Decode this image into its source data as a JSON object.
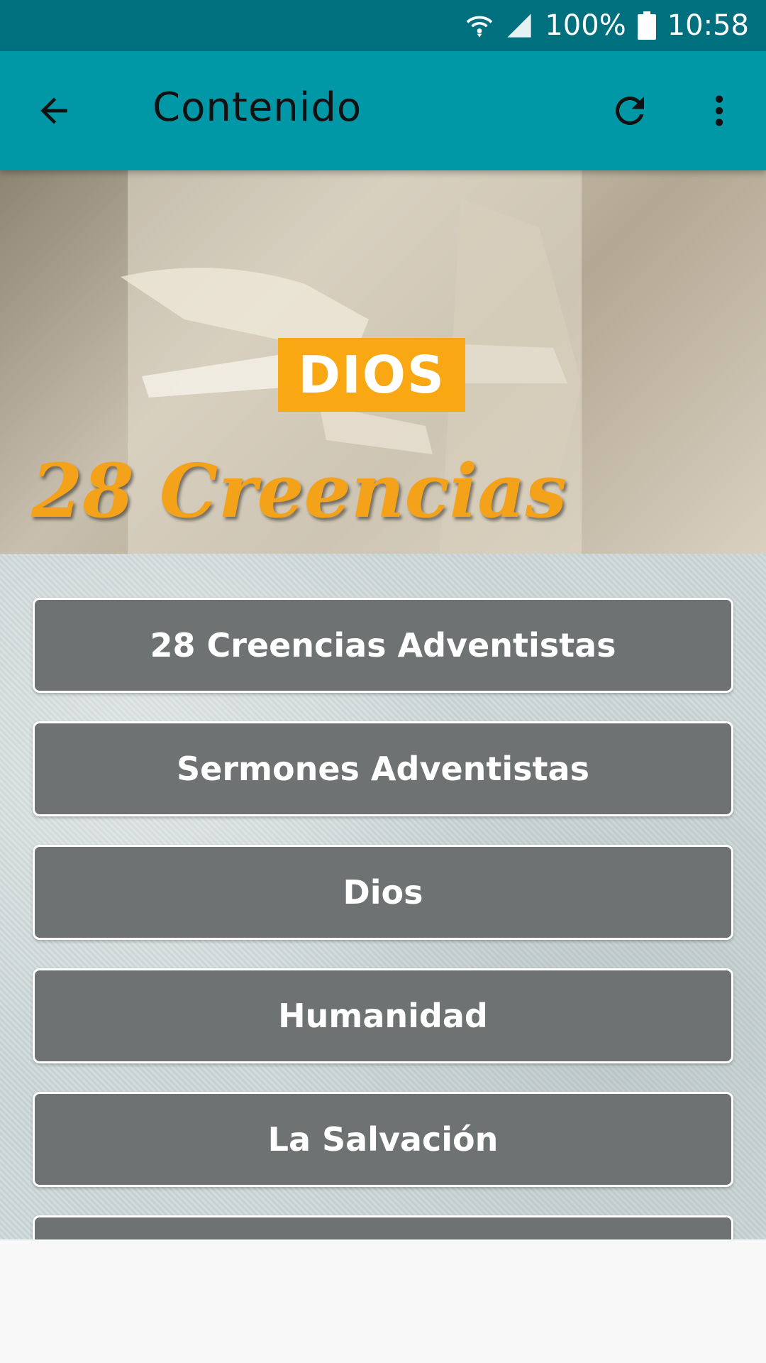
{
  "status_bar": {
    "battery": "100%",
    "time": "10:58"
  },
  "app_bar": {
    "title": "Contenido",
    "accent_color": "#0097a7"
  },
  "banner": {
    "badge_text": "DIOS",
    "logo_text": "28 Creencias",
    "badge_color": "#f9a813"
  },
  "menu": {
    "items": [
      {
        "label": "28 Creencias Adventistas"
      },
      {
        "label": "Sermones Adventistas"
      },
      {
        "label": "Dios"
      },
      {
        "label": "Humanidad"
      },
      {
        "label": "La Salvación"
      },
      {
        "label": ""
      }
    ],
    "button_color": "#6f7273"
  }
}
